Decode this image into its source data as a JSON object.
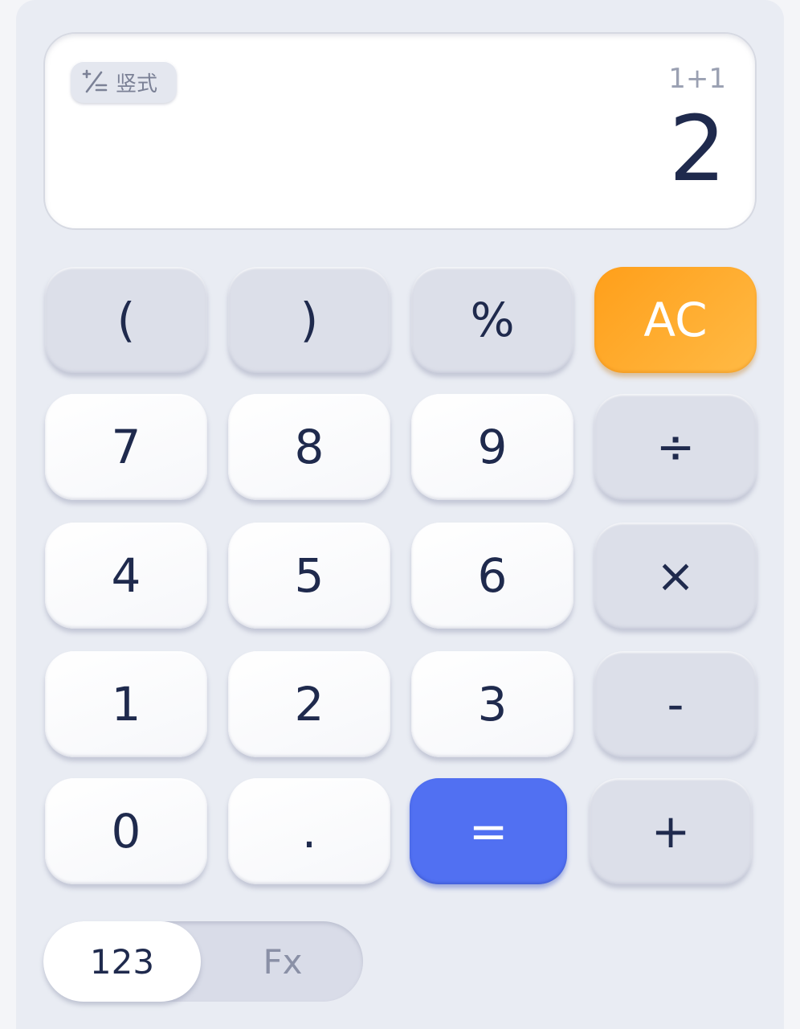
{
  "display": {
    "mode_label": "竖式",
    "expression": "1+1",
    "result": "2"
  },
  "keys": {
    "open_paren": "(",
    "close_paren": ")",
    "percent": "%",
    "clear": "AC",
    "seven": "7",
    "eight": "8",
    "nine": "9",
    "divide": "÷",
    "four": "4",
    "five": "5",
    "six": "6",
    "multiply": "×",
    "one": "1",
    "two": "2",
    "three": "3",
    "minus": "-",
    "zero": "0",
    "decimal": ".",
    "equals": "=",
    "plus": "+"
  },
  "keyboard_toggle": {
    "basic": "123",
    "function": "Fx",
    "active": "123"
  },
  "colors": {
    "clear_key": "#ffa929",
    "equals_key": "#5170f2",
    "text_dark": "#1f2a4d"
  },
  "icons": {
    "mode_chip": "vertical-arithmetic-icon"
  }
}
